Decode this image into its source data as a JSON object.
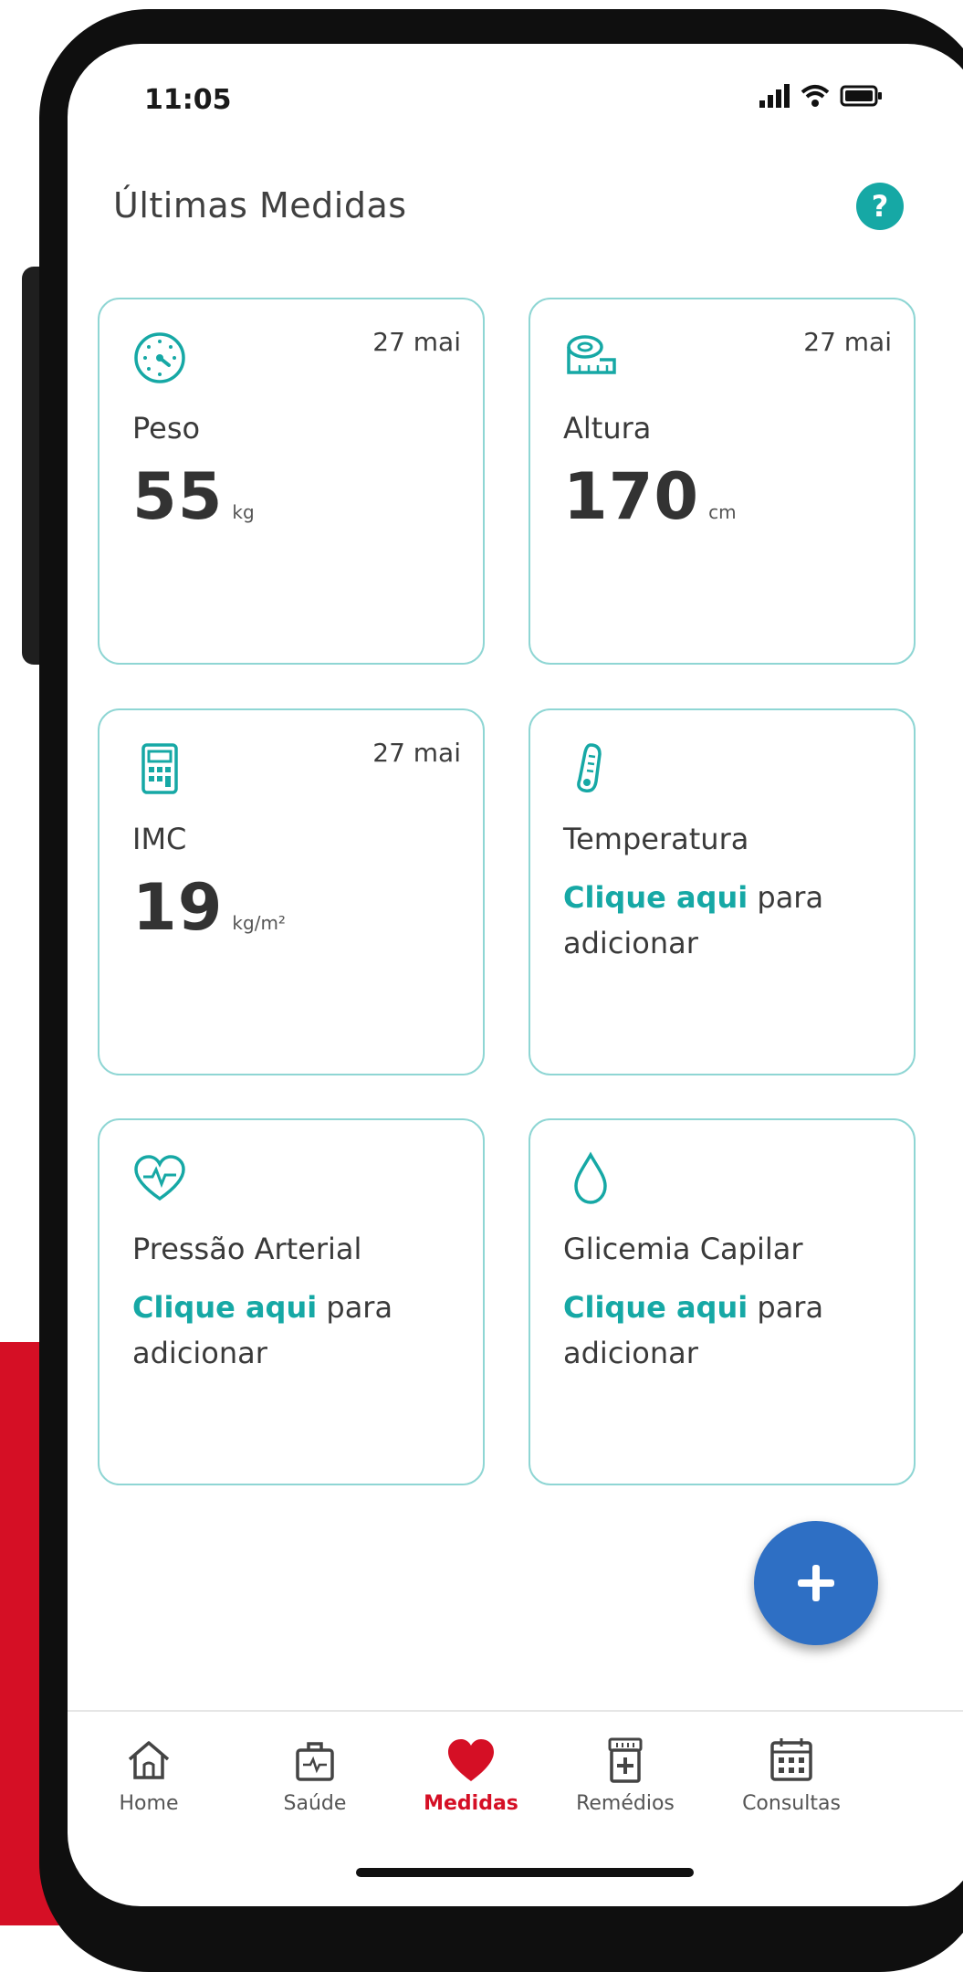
{
  "status_bar": {
    "time": "11:05"
  },
  "header": {
    "title": "Últimas Medidas",
    "help_label": "?"
  },
  "cards": [
    {
      "label": "Peso",
      "date": "27 mai",
      "value": "55",
      "unit": "kg",
      "icon": "scale-icon"
    },
    {
      "label": "Altura",
      "date": "27 mai",
      "value": "170",
      "unit": "cm",
      "icon": "measuring-tape-icon"
    },
    {
      "label": "IMC",
      "date": "27 mai",
      "value": "19",
      "unit": "kg/m²",
      "icon": "calculator-icon"
    },
    {
      "label": "Temperatura",
      "link": "Clique aqui",
      "text": "para adicionar",
      "icon": "thermometer-icon"
    },
    {
      "label": "Pressão Arterial",
      "link": "Clique aqui",
      "text": "para adicionar",
      "icon": "heart-pulse-icon"
    },
    {
      "label": "Glicemia Capilar",
      "link": "Clique aqui",
      "text": "para adicionar",
      "icon": "drop-icon"
    }
  ],
  "fab": {
    "label": "+"
  },
  "nav": [
    {
      "label": "Home",
      "icon": "home-icon"
    },
    {
      "label": "Saúde",
      "icon": "health-kit-icon"
    },
    {
      "label": "Medidas",
      "icon": "heart-icon",
      "active": true
    },
    {
      "label": "Remédios",
      "icon": "pill-box-icon"
    },
    {
      "label": "Consultas",
      "icon": "calendar-icon"
    }
  ],
  "colors": {
    "accent": "#16a8a5",
    "active": "#d50f25",
    "fab": "#2e6fc4",
    "background_band": "#d50f25"
  }
}
